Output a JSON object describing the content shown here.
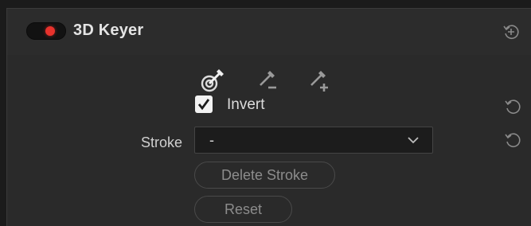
{
  "header": {
    "title": "3D Keyer",
    "enabled": true,
    "toggle_color": "#e8322c"
  },
  "pickers": [
    {
      "name": "eyedropper-picker-icon",
      "selected": true
    },
    {
      "name": "eyedropper-subtract-icon",
      "selected": false
    },
    {
      "name": "eyedropper-add-icon",
      "selected": false
    }
  ],
  "invert": {
    "label": "Invert",
    "checked": true
  },
  "stroke": {
    "label": "Stroke",
    "selected_value": "-"
  },
  "buttons": {
    "delete_stroke": "Delete Stroke",
    "reset": "Reset"
  },
  "icons": {
    "header_reset": "reset-all-icon",
    "row_reset": "reset-icon",
    "dropdown": "chevron-down-icon"
  }
}
